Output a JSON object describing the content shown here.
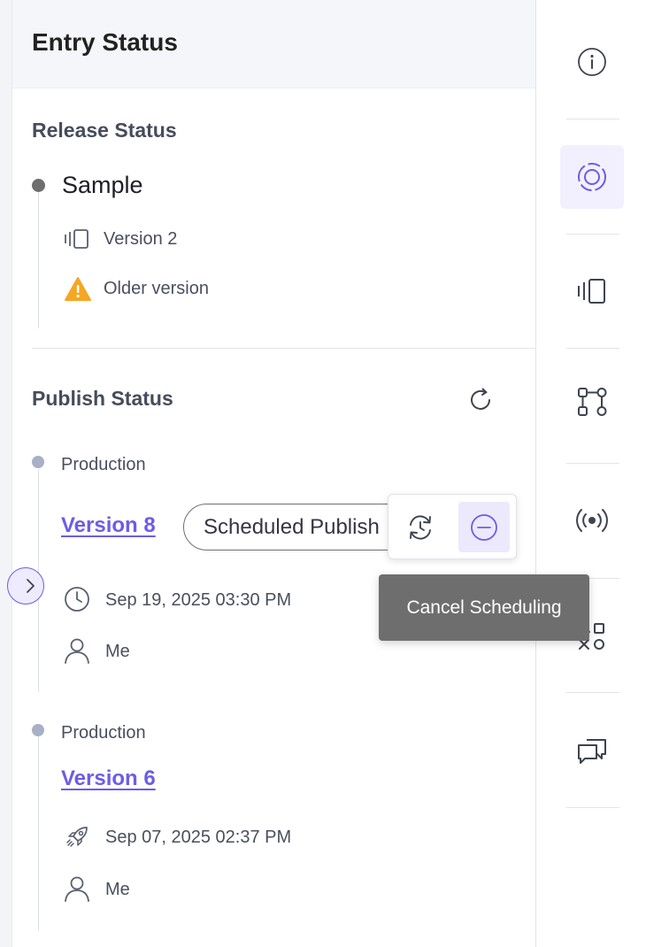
{
  "panel": {
    "title": "Entry Status"
  },
  "release": {
    "title": "Release Status",
    "name": "Sample",
    "version_label": "Version 2",
    "warning_label": "Older version"
  },
  "publish": {
    "title": "Publish Status",
    "entries": [
      {
        "environment": "Production",
        "version": "Version 8",
        "status": "Scheduled Publish",
        "datetime": "Sep 19, 2025 03:30 PM",
        "user": "Me"
      },
      {
        "environment": "Production",
        "version": "Version 6",
        "datetime": "Sep 07, 2025 02:37 PM",
        "user": "Me"
      }
    ]
  },
  "tooltip": {
    "text": "Cancel Scheduling"
  },
  "icons": {
    "refresh": "refresh-icon",
    "reschedule": "reschedule-icon",
    "cancel": "minus-circle-icon",
    "clock": "clock-icon",
    "user": "user-icon",
    "rocket": "rocket-icon",
    "version": "version-icon",
    "warning": "warning-icon",
    "chevron": "chevron-right-icon"
  },
  "rail": {
    "items": [
      "info-icon",
      "release-status-icon",
      "versions-icon",
      "workflow-icon",
      "broadcast-icon",
      "extensions-icon",
      "comments-icon"
    ]
  },
  "colors": {
    "accent": "#6c5ce7",
    "warning": "#f5a623",
    "tooltip_bg": "#6e6e6e",
    "dot_release": "#6e6e6e",
    "dot_publish": "#a8b0c8"
  }
}
